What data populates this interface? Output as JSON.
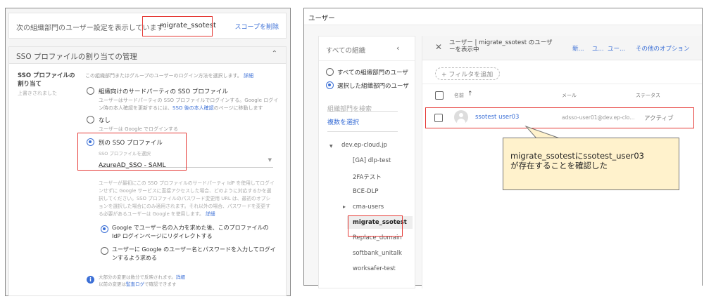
{
  "left": {
    "scope_text": "次の組織部門のユーザー設定を表示しています:",
    "scope_value": "migrate_ssotest",
    "remove_scope": "スコープを削除",
    "section_title": "SSO プロファイルの割り当ての管理",
    "setting_label": "SSO プロファイルの割り当て",
    "setting_sub": "上書きされました",
    "intro": "この組織部門またはグループのユーザーのログイン方法を選択します。",
    "intro_link": "詳細",
    "options": [
      {
        "label": "組織向けのサードパーティの SSO プロファイル",
        "desc": "ユーザーはサードパーティの SSO プロファイルでログインする。Google ログイン時の本人確認を更新するには、",
        "desc_link": "SSO 後の本人確認",
        "desc_tail": "のページに移動します",
        "selected": false
      },
      {
        "label": "なし",
        "desc": "ユーザーは Google でログインする",
        "selected": false
      },
      {
        "label": "別の SSO プロファイル",
        "selected": true
      }
    ],
    "select_label": "SSO プロファイルを選択",
    "select_value": "AzureAD_SSO - SAML",
    "explain": "ユーザーが最初にこの SSO プロファイルのサードパーティ IdP を使用してログインせずに Google サービスに直接アクセスした場合、どのように対応するかを選択してください。SSO プロファイルのパスワード変更用 URL は、最初のオプションを選択した場合にのみ適用されます。それ以外の場合、パスワードを変更する必要があるユーザーは Google を使用します。",
    "explain_link": "詳細",
    "sub_options": [
      {
        "label": "Google でユーザー名の入力を求めた後、このプロファイルの IdP ログインページにリダイレクトする",
        "selected": true
      },
      {
        "label": "ユーザーに Google のユーザー名とパスワードを入力してログインするよう求める",
        "selected": false
      }
    ],
    "info_line1": "大部分の変更は数分で反映されます。",
    "info_link1": "詳細",
    "info_line2a": "以前の変更は",
    "info_link2": "監査ログ",
    "info_line2b": "で確認できます"
  },
  "right": {
    "title": "ユーザー",
    "sidebar": {
      "heading": "すべての組織",
      "radio_all": "すべての組織部門のユーザ",
      "radio_selected": "選択した組織部門のユーザ",
      "search_placeholder": "組織部門を検索",
      "multi_select": "複数を選択",
      "root": "dev.ep-cloud.jp",
      "org_units": [
        "[GA] dlp-test",
        "2FAテスト",
        "BCE-DLP",
        "cma-users",
        "migrate_ssotest",
        "Replace_domain",
        "softbank_unitalk",
        "worksafer-test"
      ]
    },
    "header_title": "ユーザー | migrate_ssotest のユーザーを表示中",
    "actions": [
      "新...",
      "ユ...",
      "ユー...",
      "その他のオプション"
    ],
    "filter": "フィルタを追加",
    "columns": [
      "名前",
      "メール",
      "ステータス"
    ],
    "rows": [
      {
        "name": "ssotest user03",
        "email": "adsso-user01@dev.ep-clo...",
        "status": "アクティブ"
      }
    ]
  },
  "callout": {
    "line1": "migrate_ssotestにssotest_user03",
    "line2": "が存在することを確認した"
  }
}
